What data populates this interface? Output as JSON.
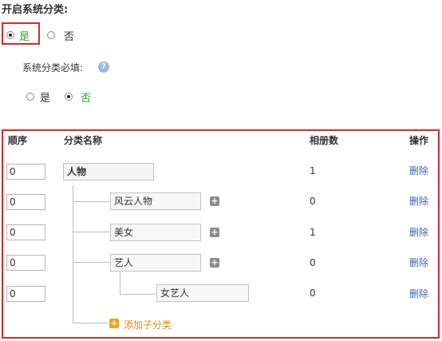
{
  "settings": {
    "title": "开启系统分类:",
    "enable_yes": "是",
    "enable_no": "否",
    "required_label": "系统分类必填:",
    "required_yes": "是",
    "required_no": "否",
    "help_glyph": "?"
  },
  "table": {
    "headers": {
      "order": "顺序",
      "name": "分类名称",
      "count": "相册数",
      "action": "操作"
    },
    "rows": [
      {
        "order": "0",
        "name": "人物",
        "count": "1",
        "action": "删除",
        "add_glyph": ""
      },
      {
        "order": "0",
        "name": "风云人物",
        "count": "0",
        "action": "删除",
        "add_glyph": "+"
      },
      {
        "order": "0",
        "name": "美女",
        "count": "1",
        "action": "删除",
        "add_glyph": "+"
      },
      {
        "order": "0",
        "name": "艺人",
        "count": "0",
        "action": "删除",
        "add_glyph": "+"
      },
      {
        "order": "0",
        "name": "女艺人",
        "count": "0",
        "action": "删除",
        "add_glyph": ""
      }
    ],
    "add_child_label": "添加子分类",
    "add_child_glyph": "+"
  },
  "colors": {
    "highlight_border": "#d42a2a",
    "selected_green": "#2aa52a",
    "link_blue": "#3b66b5",
    "add_orange": "#e08a10"
  },
  "icons": {
    "help": "question-circle-icon",
    "plus": "plus-square-icon",
    "add": "add-square-icon"
  },
  "state": {
    "enable_system_category": "是",
    "system_category_required": "否"
  }
}
